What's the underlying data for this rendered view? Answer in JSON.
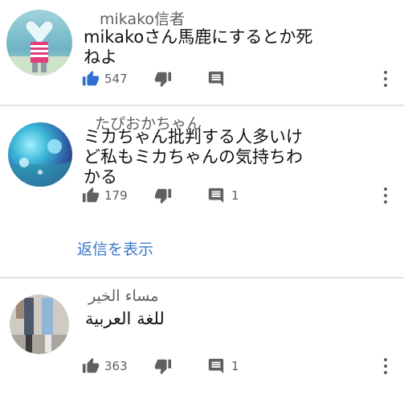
{
  "comments": [
    {
      "author": "mikako信者",
      "text": "mikakoさん馬鹿にするとか死\nねよ",
      "likes": "547",
      "replies_count": ""
    },
    {
      "author": "たぴおかちゃん",
      "text": "ミカちゃん批判する人多いけ\nど私もミカちゃんの気持ちわ\nかる",
      "likes": "179",
      "replies_count": "1"
    },
    {
      "author": "مساء الخير",
      "text": "للغة العربية",
      "likes": "363",
      "replies_count": "1"
    }
  ],
  "show_replies_label": "返信を表示",
  "icons": {
    "like": "thumbs-up-icon",
    "dislike": "thumbs-down-icon",
    "reply": "reply-icon",
    "more": "more-vertical-icon"
  },
  "colors": {
    "link": "#3b78c9",
    "like_active": "#2f6fd1",
    "icon": "#606060",
    "divider": "#e4e4e4"
  }
}
